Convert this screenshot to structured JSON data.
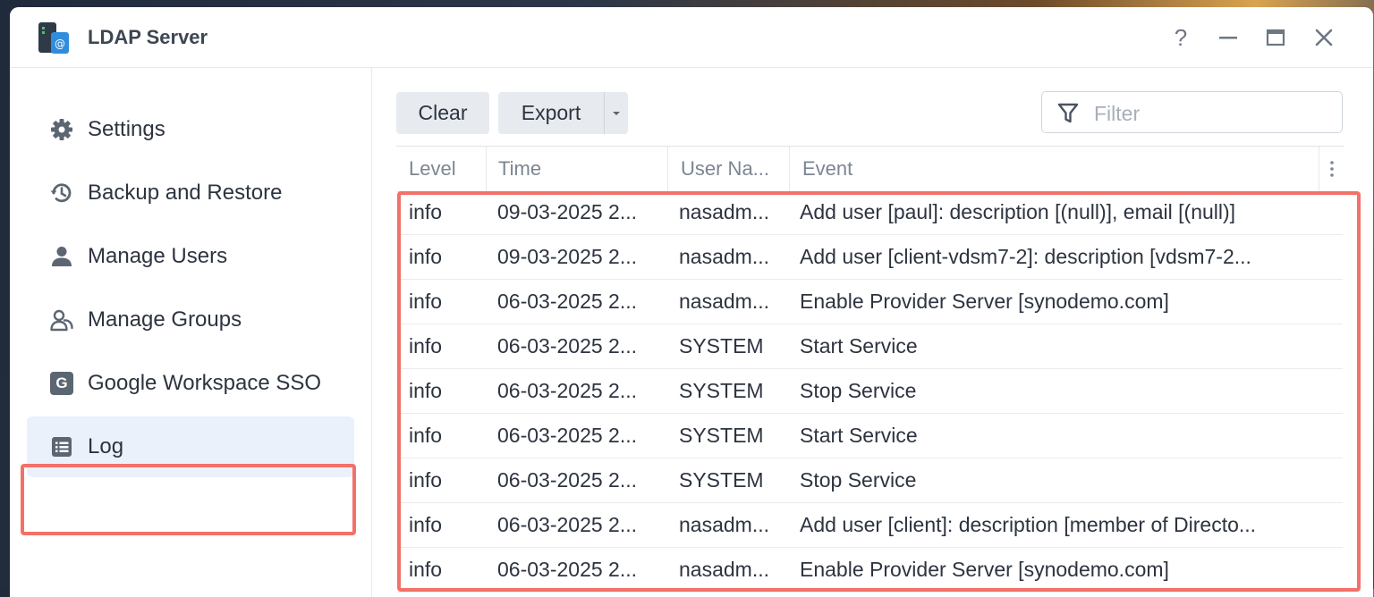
{
  "window": {
    "title": "LDAP Server",
    "app_icon": "ldap-server-app-icon",
    "controls": [
      "help-icon",
      "minimize-icon",
      "maximize-icon",
      "close-icon"
    ],
    "help_label": "?"
  },
  "sidebar": {
    "items": [
      {
        "label": "Settings",
        "icon": "gear-icon"
      },
      {
        "label": "Backup and Restore",
        "icon": "history-icon"
      },
      {
        "label": "Manage Users",
        "icon": "user-icon"
      },
      {
        "label": "Manage Groups",
        "icon": "group-icon"
      },
      {
        "label": "Google Workspace SSO",
        "icon": "google-g-icon",
        "icon_glyph": "G"
      },
      {
        "label": "Log",
        "icon": "log-list-icon",
        "active": true
      }
    ]
  },
  "toolbar": {
    "clear_label": "Clear",
    "export_label": "Export",
    "filter_placeholder": "Filter"
  },
  "table": {
    "columns": [
      "Level",
      "Time",
      "User Na...",
      "Event"
    ],
    "rows": [
      {
        "level": "info",
        "time": "09-03-2025 2...",
        "user": "nasadm...",
        "event": "Add user [paul]: description [(null)], email [(null)]"
      },
      {
        "level": "info",
        "time": "09-03-2025 2...",
        "user": "nasadm...",
        "event": "Add user [client-vdsm7-2]: description [vdsm7-2..."
      },
      {
        "level": "info",
        "time": "06-03-2025 2...",
        "user": "nasadm...",
        "event": "Enable Provider Server [synodemo.com]"
      },
      {
        "level": "info",
        "time": "06-03-2025 2...",
        "user": "SYSTEM",
        "event": "Start Service"
      },
      {
        "level": "info",
        "time": "06-03-2025 2...",
        "user": "SYSTEM",
        "event": "Stop Service"
      },
      {
        "level": "info",
        "time": "06-03-2025 2...",
        "user": "SYSTEM",
        "event": "Start Service"
      },
      {
        "level": "info",
        "time": "06-03-2025 2...",
        "user": "SYSTEM",
        "event": "Stop Service"
      },
      {
        "level": "info",
        "time": "06-03-2025 2...",
        "user": "nasadm...",
        "event": "Add user [client]: description [member of Directo..."
      },
      {
        "level": "info",
        "time": "06-03-2025 2...",
        "user": "nasadm...",
        "event": "Enable Provider Server [synodemo.com]"
      }
    ]
  },
  "colors": {
    "highlight": "#f27168",
    "active_nav_bg": "#eaf1fb",
    "button_bg": "#e7ebf0",
    "text": "#2d3440",
    "muted": "#7c8593"
  }
}
